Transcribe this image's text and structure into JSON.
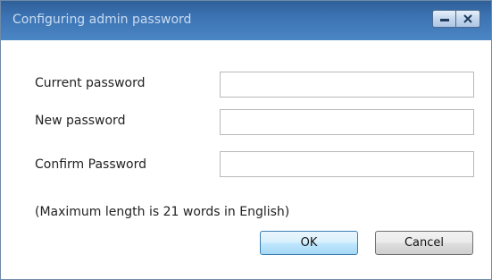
{
  "window": {
    "title": "Configuring admin password",
    "controls": {
      "minimize_icon": "minimize-icon",
      "close_icon": "close-icon"
    }
  },
  "form": {
    "fields": [
      {
        "label": "Current password",
        "value": ""
      },
      {
        "label": "New password",
        "value": ""
      },
      {
        "label": "Confirm Password",
        "value": ""
      }
    ],
    "note": "(Maximum length is 21 words in English)"
  },
  "buttons": {
    "ok": "OK",
    "cancel": "Cancel"
  }
}
